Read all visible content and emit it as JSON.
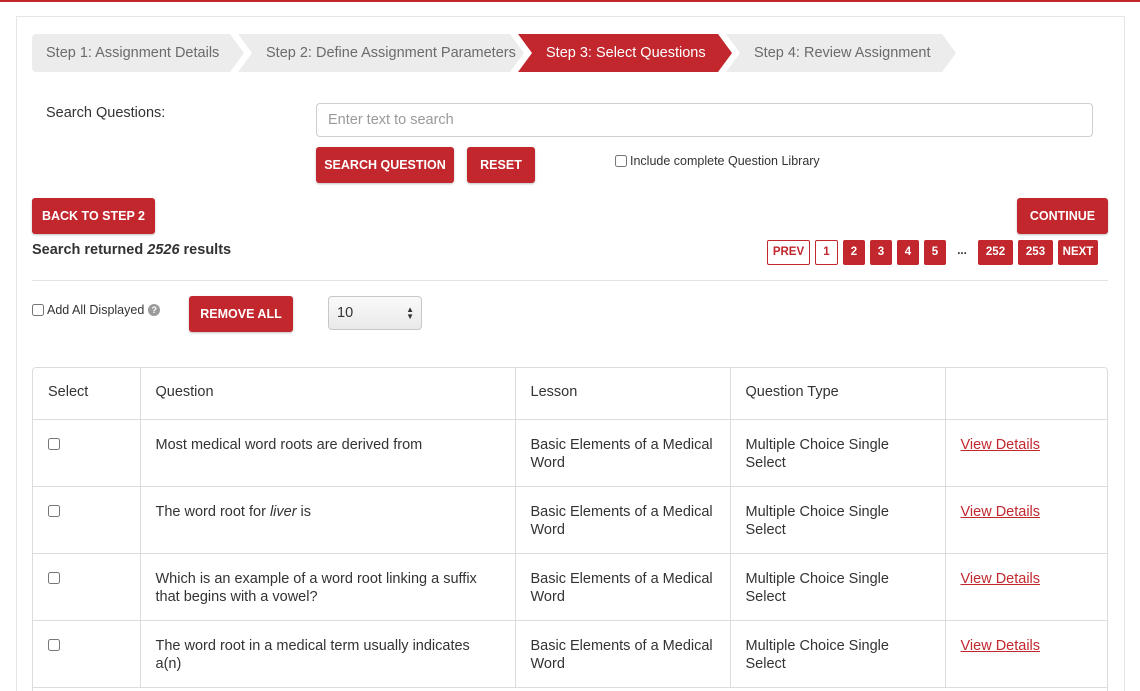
{
  "wizard": {
    "steps": [
      {
        "label": "Step 1: Assignment Details",
        "active": false
      },
      {
        "label": "Step 2: Define Assignment Parameters",
        "active": false
      },
      {
        "label": "Step 3: Select Questions",
        "active": true
      },
      {
        "label": "Step 4: Review Assignment",
        "active": false
      }
    ]
  },
  "search": {
    "label": "Search Questions:",
    "placeholder": "Enter text to search",
    "value": "",
    "search_button": "SEARCH QUESTION",
    "reset_button": "RESET",
    "include_library_label": "Include complete Question Library",
    "include_library_checked": false
  },
  "nav": {
    "back_button": "BACK TO STEP 2",
    "continue_button": "CONTINUE"
  },
  "results": {
    "prefix": "Search returned ",
    "count": "2526",
    "suffix": " results"
  },
  "pagination": {
    "prev": "PREV",
    "pages": [
      "1",
      "2",
      "3",
      "4",
      "5"
    ],
    "current": "1",
    "ellipsis": "...",
    "last_pages": [
      "252",
      "253"
    ],
    "next": "NEXT"
  },
  "bulk": {
    "add_all_label": "Add All Displayed",
    "help_icon": "question-circle-icon",
    "remove_all_button": "REMOVE ALL",
    "per_page": "10"
  },
  "table": {
    "headers": [
      "Select",
      "Question",
      "Lesson",
      "Question Type",
      ""
    ],
    "rows": [
      {
        "question_pre": "Most medical word roots are derived from",
        "question_italic": "",
        "question_post": "",
        "lesson": "Basic Elements of a Medical Word",
        "type": "Multiple Choice Single Select",
        "link": "View Details"
      },
      {
        "question_pre": "The word root for ",
        "question_italic": "liver",
        "question_post": " is",
        "lesson": "Basic Elements of a Medical Word",
        "type": "Multiple Choice Single Select",
        "link": "View Details"
      },
      {
        "question_pre": "Which is an example of a word root linking a suffix that begins with a vowel?",
        "question_italic": "",
        "question_post": "",
        "lesson": "Basic Elements of a Medical Word",
        "type": "Multiple Choice Single Select",
        "link": "View Details"
      },
      {
        "question_pre": "The word root in a medical term usually indicates a(n)",
        "question_italic": "",
        "question_post": "",
        "lesson": "Basic Elements of a Medical Word",
        "type": "Multiple Choice Single Select",
        "link": "View Details"
      }
    ]
  },
  "colors": {
    "accent": "#c1272d",
    "step_inactive_bg": "#ececec",
    "step_inactive_text": "#6b6b6b"
  }
}
